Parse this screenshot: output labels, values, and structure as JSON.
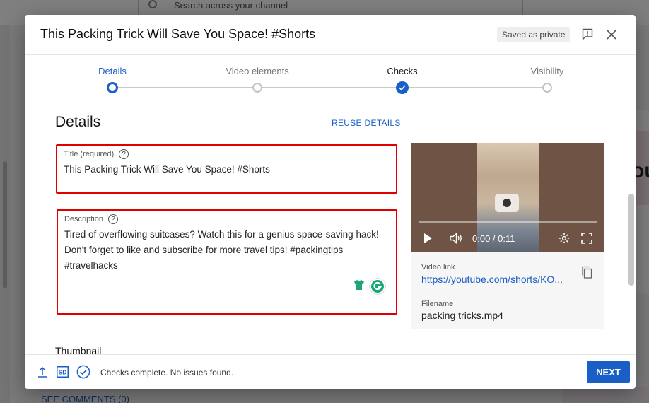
{
  "background": {
    "search_placeholder": "Search across your channel",
    "see_comments": "SEE COMMENTS (0)",
    "right_card_text": "ou"
  },
  "dialog": {
    "title": "This Packing Trick Will Save You Space! #Shorts",
    "saved_badge": "Saved as private",
    "icons": [
      "feedback-icon",
      "close-icon"
    ]
  },
  "stepper": {
    "steps": [
      {
        "label": "Details",
        "state": "active"
      },
      {
        "label": "Video elements",
        "state": "pending"
      },
      {
        "label": "Checks",
        "state": "done"
      },
      {
        "label": "Visibility",
        "state": "pending"
      }
    ]
  },
  "details": {
    "heading": "Details",
    "reuse_label": "REUSE DETAILS",
    "title_label": "Title (required)",
    "title_value": "This Packing Trick Will Save You Space! #Shorts",
    "description_label": "Description",
    "description_value": "Tired of overflowing suitcases? Watch this for a genius space-saving hack!\nDon't forget to like and subscribe for more travel tips! #packingtips\n#travelhacks",
    "thumbnail_heading": "Thumbnail",
    "help_glyph": "?"
  },
  "video": {
    "time": "0:00 / 0:11",
    "link_label": "Video link",
    "link_value": "https://youtube.com/shorts/KO...",
    "filename_label": "Filename",
    "filename_value": "packing tricks.mp4"
  },
  "footer": {
    "status": "Checks complete. No issues found.",
    "sd_label": "SD",
    "next_label": "NEXT"
  },
  "colors": {
    "accent": "#1a5fc8",
    "highlight_border": "#e00000"
  }
}
